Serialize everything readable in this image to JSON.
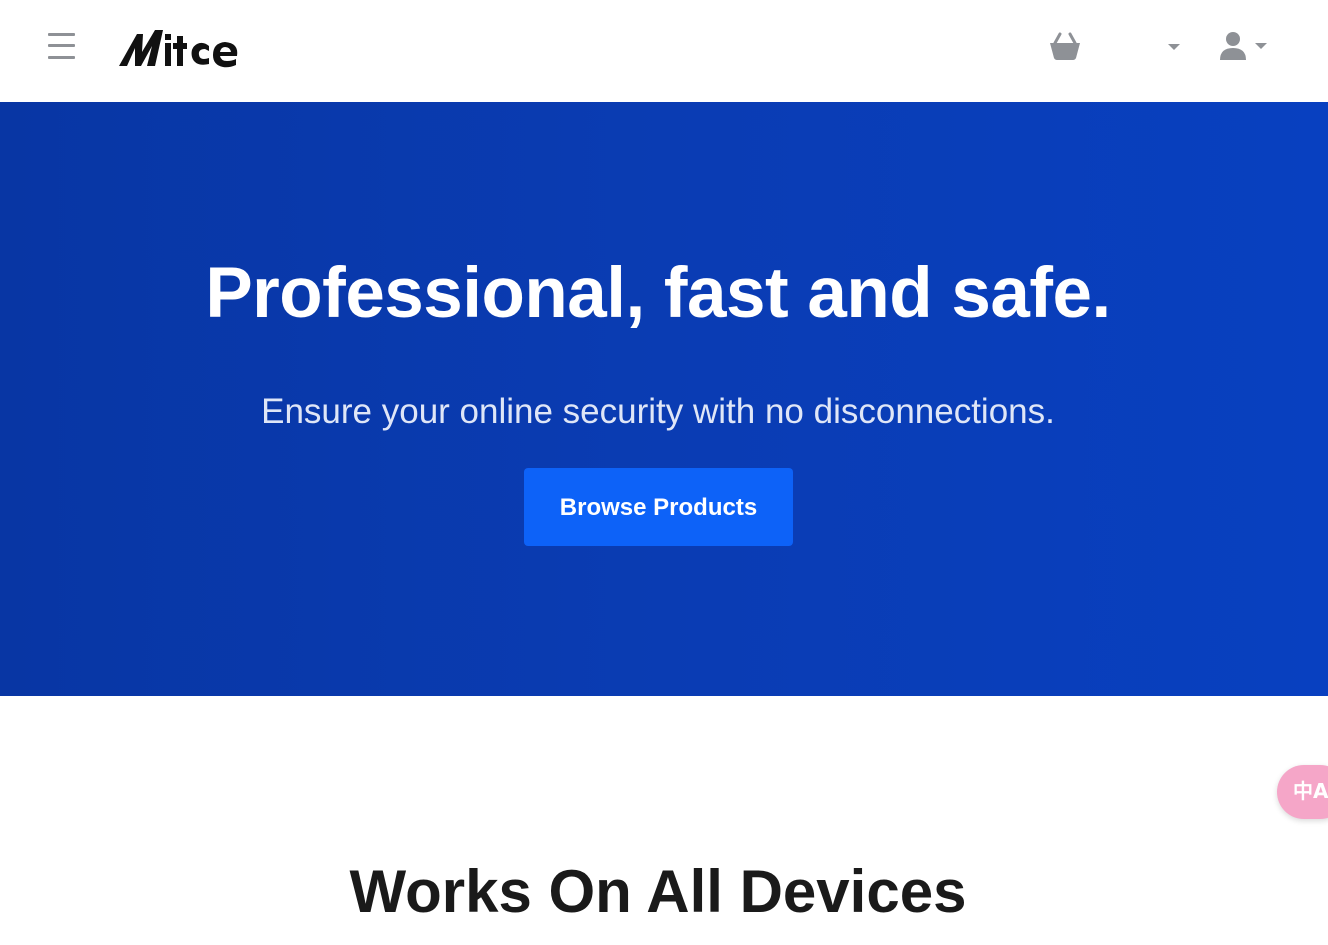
{
  "header": {
    "logo_text": "Mitce",
    "menu_icon": "hamburger-menu-icon",
    "cart_icon": "basket-icon",
    "currency_dropdown_icon": "caret-down-icon",
    "account_icon": "user-icon"
  },
  "hero": {
    "title": "Professional, fast and safe.",
    "subtitle": "Ensure your online security with no disconnections.",
    "cta_label": "Browse Products",
    "background_color": "#0a3cb3",
    "cta_color": "#0d62f8"
  },
  "translate_widget": {
    "label": "中A",
    "icon": "translate-icon",
    "color": "#f5a6c8"
  },
  "features": {
    "title": "Works On All Devices"
  }
}
